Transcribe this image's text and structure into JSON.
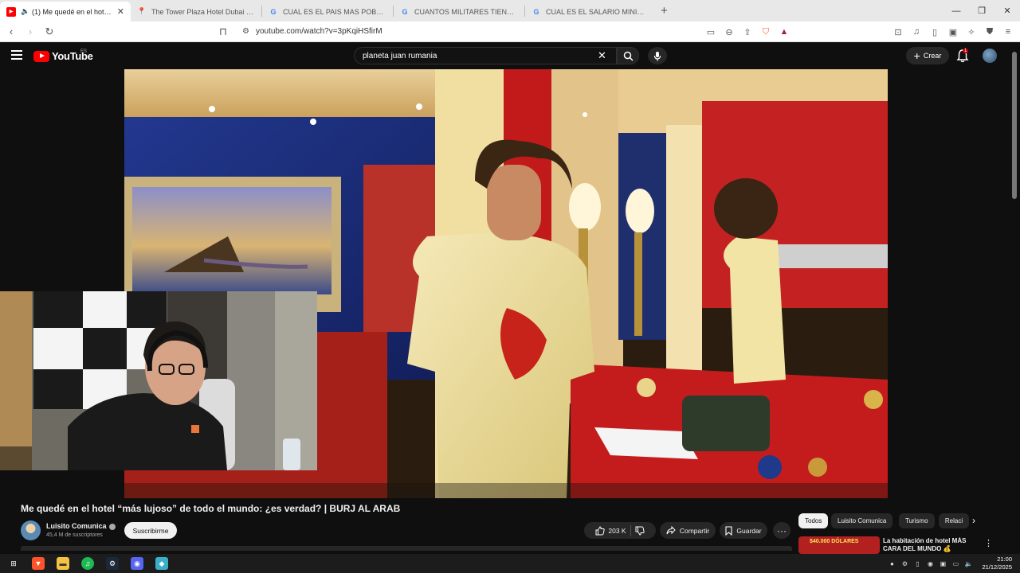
{
  "browser": {
    "tabs": [
      {
        "label": "(1) Me quedé en el hotel \"má",
        "favicon": "youtube-icon",
        "active": true
      },
      {
        "label": "The Tower Plaza Hotel Dubai - Goog",
        "favicon": "maps-icon",
        "active": false
      },
      {
        "label": "CUAL ES EL PAIS MAS POBLADO DE",
        "favicon": "google-icon",
        "active": false
      },
      {
        "label": "CUANTOS MILITARES TIENE EEUU - B",
        "favicon": "google-icon",
        "active": false
      },
      {
        "label": "CUAL ES EL SALARIO MINIMO EN BU",
        "favicon": "google-icon",
        "active": false
      }
    ],
    "new_tab": "+",
    "url": "youtube.com/watch?v=3pKqiHSfirM"
  },
  "youtube": {
    "logo_text": "YouTube",
    "country_code": "ES",
    "search_value": "planeta juan rumania",
    "create_label": "Crear",
    "notification_count": "1"
  },
  "video": {
    "title": "Me quedé en el hotel “más lujoso” de todo el mundo: ¿es verdad? | BURJ AL ARAB",
    "channel_name": "Luisito Comunica",
    "subscribers": "45,4 M de suscriptores",
    "subscribe_label": "Suscribirme",
    "likes": "203 K",
    "share_label": "Compartir",
    "save_label": "Guardar"
  },
  "chips": [
    "Todos",
    "Luisito Comunica",
    "Turismo",
    "Relaci"
  ],
  "recommendation": {
    "title": "La habitación de hotel MÁS CARA DEL MUNDO 💰",
    "thumb_text": "$40.000 DÓLARES"
  },
  "taskbar": {
    "time": "21:00",
    "date": "21/12/2025"
  },
  "colors": {
    "youtube_red": "#ff0000",
    "page_bg": "#0f0f0f"
  }
}
